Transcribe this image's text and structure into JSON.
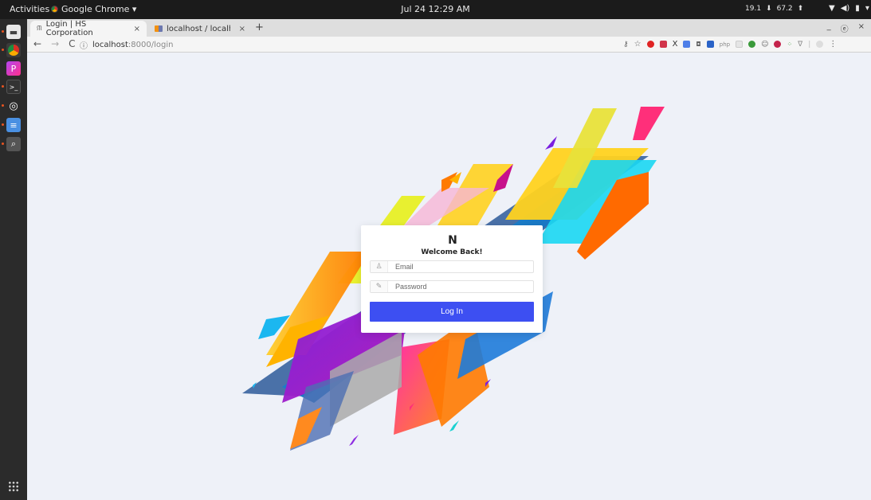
{
  "topbar": {
    "activities": "Activities",
    "app_name": "Google Chrome ▾",
    "clock": "Jul 24  12:29 AM",
    "net_down": "19.1",
    "net_up": "67.2",
    "icons": [
      "wifi-icon",
      "volume-icon",
      "battery-icon",
      "chevron-down-icon"
    ]
  },
  "dock": {
    "items": [
      "files-icon",
      "chrome-icon",
      "phpstorm-icon",
      "terminal-icon",
      "settings-icon",
      "text-editor-icon",
      "image-viewer-icon"
    ],
    "apps_grid": "show-applications-icon"
  },
  "browser": {
    "tabs": [
      {
        "label": "Login | HS Corporation",
        "favicon": "hs"
      },
      {
        "label": "localhost / localhost / po",
        "favicon": "phpmyadmin"
      }
    ],
    "new_tab": "+",
    "window_controls": {
      "minimize": "_",
      "restore": "ⓔ",
      "close": "×"
    },
    "url_host": "localhost",
    "url_path": ":8000/login"
  },
  "login": {
    "logo": "N",
    "welcome": "Welcome Back!",
    "email_placeholder": "Email",
    "password_placeholder": "Password",
    "button": "Log In"
  },
  "colors": {
    "accent": "#3d4ff2",
    "page_bg": "#eef1f8"
  }
}
